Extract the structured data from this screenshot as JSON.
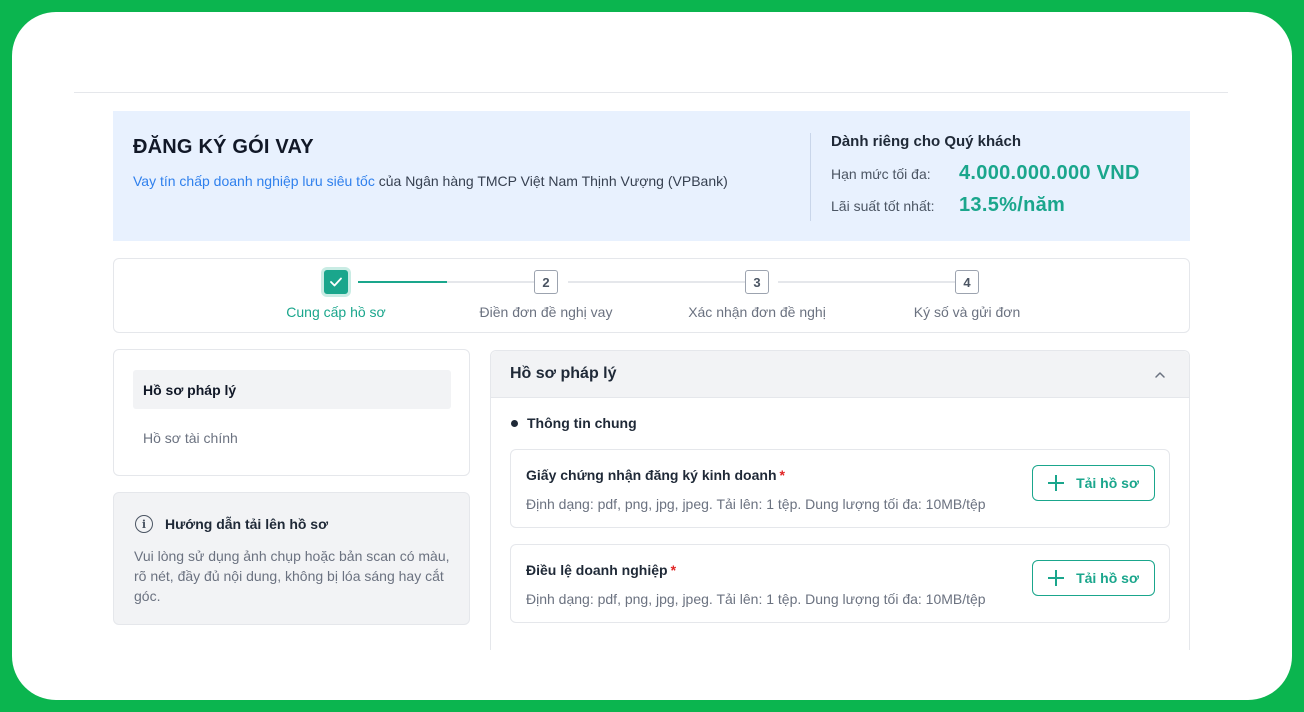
{
  "banner": {
    "title": "ĐĂNG KÝ GÓI VAY",
    "product_link": "Vay tín chấp doanh nghiệp lưu siêu tốc",
    "provider_text": " của Ngân hàng TMCP Việt Nam Thịnh Vượng (VPBank)",
    "offer_title": "Dành riêng cho Quý khách",
    "limit_label": "Hạn mức tối đa:",
    "limit_value": "4.000.000.000 VND",
    "rate_label": "Lãi suất tốt nhất:",
    "rate_value": "13.5%/năm"
  },
  "stepper": {
    "steps": [
      {
        "number": "1",
        "label": "Cung cấp hồ sơ",
        "status": "done"
      },
      {
        "number": "2",
        "label": "Điền đơn đề nghị vay",
        "status": "pending"
      },
      {
        "number": "3",
        "label": "Xác nhận đơn đề nghị",
        "status": "pending"
      },
      {
        "number": "4",
        "label": "Ký số và gửi đơn",
        "status": "pending"
      }
    ],
    "progress_first_connector": 0.5
  },
  "nav": {
    "items": [
      {
        "label": "Hồ sơ pháp lý",
        "active": true
      },
      {
        "label": "Hồ sơ tài chính",
        "active": false
      }
    ]
  },
  "guide": {
    "icon": "info-icon",
    "title": "Hướng dẫn tải lên hồ sơ",
    "body": "Vui lòng sử dụng ảnh chụp hoặc bản scan có màu, rõ nét, đầy đủ nội dung, không bị lóa sáng hay cắt góc."
  },
  "panel": {
    "title": "Hồ sơ pháp lý",
    "section_title": "Thông tin chung",
    "documents": [
      {
        "name": "Giấy chứng nhận đăng ký kinh doanh",
        "required_mark": "*",
        "hint": "Định dạng: pdf, png, jpg, jpeg. Tải lên: 1 tệp. Dung lượng tối đa: 10MB/tệp",
        "button_label": "Tải hồ sơ"
      },
      {
        "name": "Điều lệ doanh nghiệp",
        "required_mark": "*",
        "hint": "Định dạng: pdf, png, jpg, jpeg. Tải lên: 1 tệp. Dung lượng tối đa: 10MB/tệp",
        "button_label": "Tải hồ sơ"
      }
    ]
  },
  "colors": {
    "frame_border": "#0bb54f",
    "accent": "#1aa68c",
    "link": "#2f80ed",
    "banner_bg": "#e8f1fe",
    "required": "#e02424"
  }
}
